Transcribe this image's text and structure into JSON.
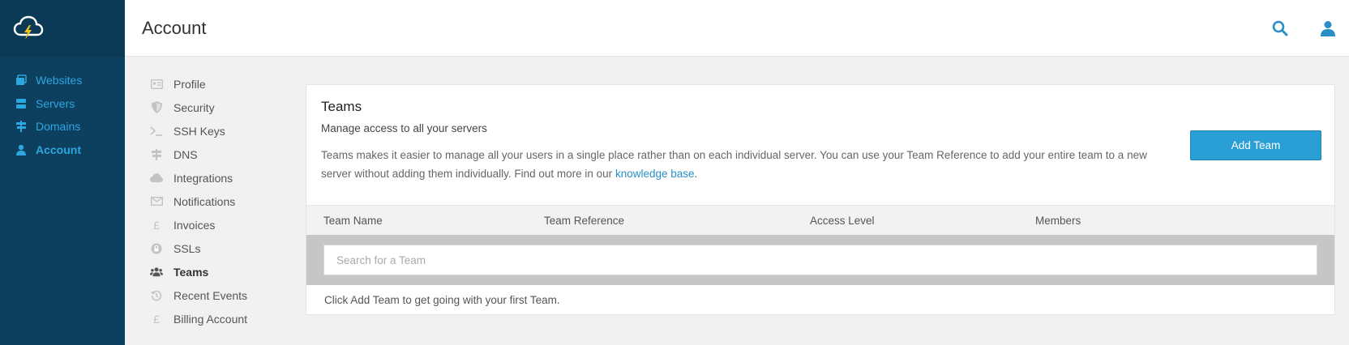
{
  "header": {
    "title": "Account"
  },
  "leftnav": {
    "items": [
      {
        "label": "Websites",
        "icon": "websites-icon"
      },
      {
        "label": "Servers",
        "icon": "servers-icon"
      },
      {
        "label": "Domains",
        "icon": "domains-icon"
      },
      {
        "label": "Account",
        "icon": "account-icon",
        "active": true
      }
    ]
  },
  "subnav": {
    "items": [
      {
        "label": "Profile",
        "icon": "id-card-icon"
      },
      {
        "label": "Security",
        "icon": "shield-icon"
      },
      {
        "label": "SSH Keys",
        "icon": "terminal-icon"
      },
      {
        "label": "DNS",
        "icon": "signpost-icon"
      },
      {
        "label": "Integrations",
        "icon": "cloud-icon"
      },
      {
        "label": "Notifications",
        "icon": "envelope-icon"
      },
      {
        "label": "Invoices",
        "icon": "pound-icon"
      },
      {
        "label": "SSLs",
        "icon": "lock-icon"
      },
      {
        "label": "Teams",
        "icon": "users-icon",
        "active": true
      },
      {
        "label": "Recent Events",
        "icon": "history-icon"
      },
      {
        "label": "Billing Account",
        "icon": "pound-icon"
      }
    ]
  },
  "teams": {
    "title": "Teams",
    "subtitle": "Manage access to all your servers",
    "description": "Teams makes it easier to manage all your users in a single place rather than on each individual server. You can use your Team Reference to add your entire team to a new server without adding them individually. Find out more in our ",
    "link_text": "knowledge base",
    "description_end": ".",
    "add_button": "Add Team",
    "columns": [
      "Team Name",
      "Team Reference",
      "Access Level",
      "Members"
    ],
    "search_placeholder": "Search for a Team",
    "empty_message": "Click Add Team to get going with your first Team."
  },
  "colors": {
    "sidebar_bg": "#0d3f5e",
    "accent": "#2da7e0",
    "button": "#2a9fd6"
  }
}
